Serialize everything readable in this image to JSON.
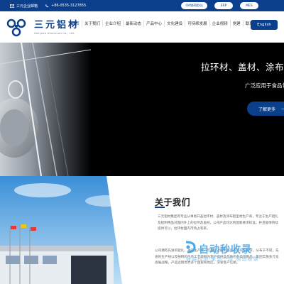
{
  "topbar": {
    "mail_label": "三元企业邮箱",
    "phone": "+86-0535-3127855",
    "buttons": [
      "OA协同办公",
      "ERP",
      "MES"
    ]
  },
  "brand": {
    "name_cn": "三元铝材",
    "name_en": "Sanyuan Aluminum Co., Ltd."
  },
  "nav": {
    "items": [
      "首页",
      "关于我们",
      "企业介绍",
      "最新动态",
      "产品中心",
      "文化建设",
      "可持续发展",
      "企业视频",
      "党建",
      "联系我们"
    ],
    "lang": "English"
  },
  "hero": {
    "title": "拉环材、盖材、涂布铝",
    "subtitle": "广泛应用于食品包装",
    "button": "了解更多",
    "arrow": "⟶"
  },
  "about": {
    "title": "关于我们",
    "text": "三元铝材集团有专业从事易开盖拉环材、盖材及涂布铝型材生产商，专注于生产铝扎及铝制用品对国内外上的拉环及盖材，公司产品均达到国家要求标准。并且能够持续提供可以，拉环材国内市场占有率。",
    "lower": "公司拥有先进的铝扎、冲压生产线、可满足对铝制品品质不同的需求，分布于不同，先进的生产线以及独特的生产工艺能够为客户提供高品质的各类铝制品。集团实施多元化发展战略，产品远销世界多个国家和地区，深受客户信赖。"
  },
  "watermark": {
    "title": "自动秒收录",
    "subtitle": "智能检测·来访一次·自动收录"
  },
  "colors": {
    "brand_blue": "#0b3f8c",
    "watermark_blue": "#4aa8e8"
  }
}
